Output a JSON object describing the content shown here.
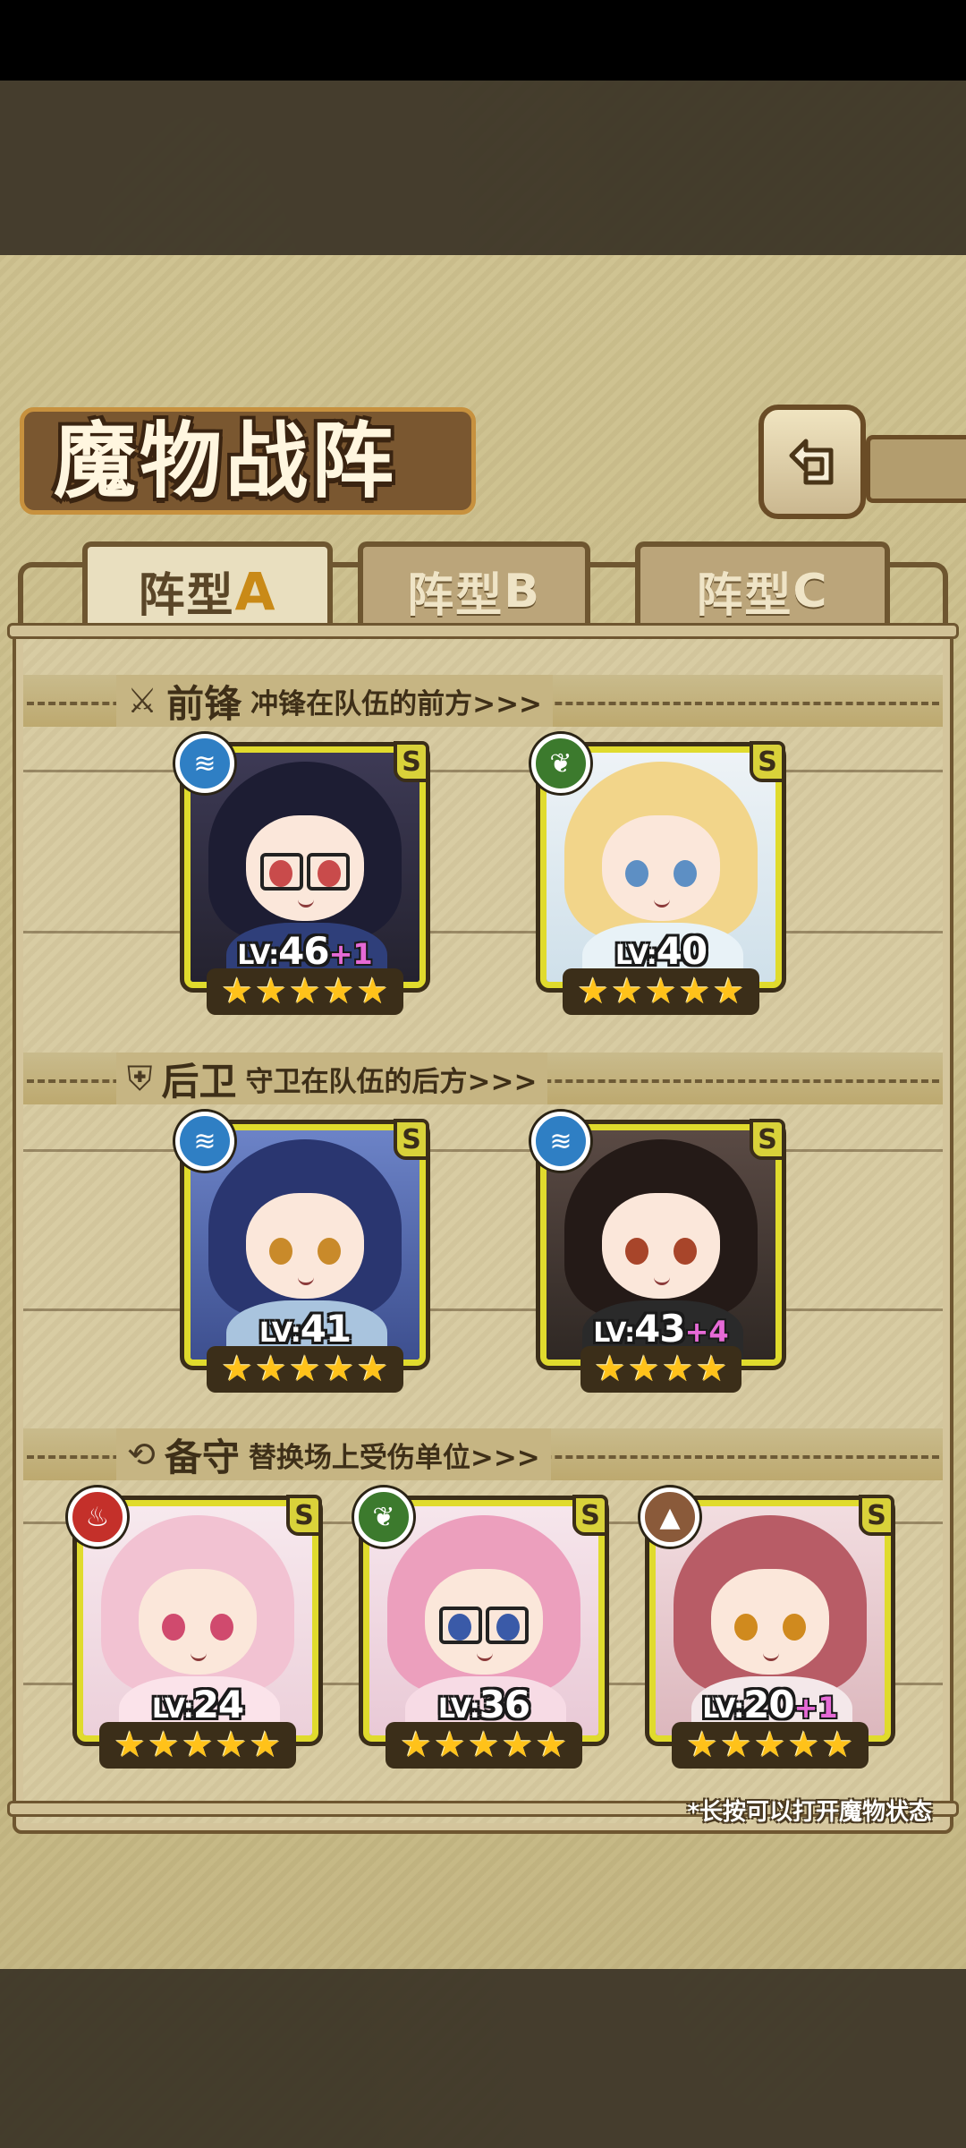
{
  "header": {
    "title": "魔物战阵",
    "back_icon": "return-arrow-icon"
  },
  "tabs": [
    {
      "prefix": "阵型",
      "letter": "A",
      "active": true
    },
    {
      "prefix": "阵型",
      "letter": "B",
      "active": false
    },
    {
      "prefix": "阵型",
      "letter": "C",
      "active": false
    }
  ],
  "sections": {
    "vanguard": {
      "icon": "sword-icon",
      "title": "前锋",
      "subtitle": "冲锋在队伍的前方>>>"
    },
    "rearguard": {
      "icon": "shield-icon",
      "title": "后卫",
      "subtitle": "守卫在队伍的后方>>>"
    },
    "reserve": {
      "icon": "swap-icon",
      "title": "备守",
      "subtitle": "替换场上受伤单位>>>"
    }
  },
  "cards": {
    "v1": {
      "element": "water",
      "rank": "S",
      "lv_prefix": "LV:",
      "level": "46",
      "bonus": "+1",
      "stars": 5
    },
    "v2": {
      "element": "wood",
      "rank": "S",
      "lv_prefix": "LV:",
      "level": "40",
      "bonus": "",
      "stars": 5
    },
    "r1": {
      "element": "water",
      "rank": "S",
      "lv_prefix": "LV:",
      "level": "41",
      "bonus": "",
      "stars": 5
    },
    "r2": {
      "element": "water",
      "rank": "S",
      "lv_prefix": "LV:",
      "level": "43",
      "bonus": "+4",
      "stars": 4
    },
    "b1": {
      "element": "fire",
      "rank": "S",
      "lv_prefix": "LV:",
      "level": "24",
      "bonus": "",
      "stars": 5
    },
    "b2": {
      "element": "wood",
      "rank": "S",
      "lv_prefix": "LV:",
      "level": "36",
      "bonus": "",
      "stars": 5
    },
    "b3": {
      "element": "earth",
      "rank": "S",
      "lv_prefix": "LV:",
      "level": "20",
      "bonus": "+1",
      "stars": 5
    }
  },
  "footer": {
    "hint": "*长按可以打开魔物状态"
  },
  "colors": {
    "card_border": "#e0db2d",
    "star": "#ffc21a",
    "bonus": "#e66ad6",
    "active_tab_letter": "#c98a17"
  }
}
